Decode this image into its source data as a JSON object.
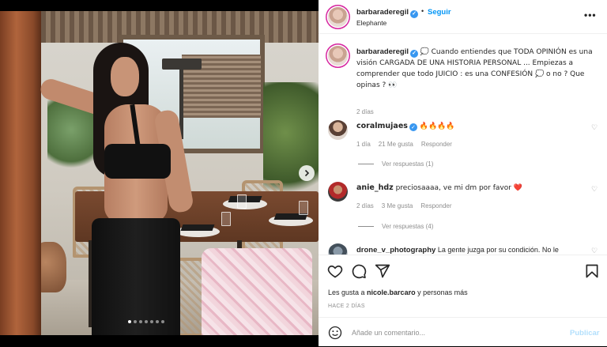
{
  "post": {
    "username": "barbaraderegil",
    "follow_label": "Seguir",
    "location": "Elephante",
    "caption": "💭 Cuando entiendes que TODA OPINIÓN es una visión CARGADA DE UNA HISTORIA PERSONAL ... Empiezas a comprender que todo JUICIO : es una CONFESIÓN 💭 o no ? Que opinas ? 👀",
    "caption_time": "2 días",
    "carousel": {
      "slide_count": 7,
      "active_index": 0
    }
  },
  "comments": [
    {
      "username": "coralmujaes",
      "text": "🔥🔥🔥🔥",
      "time": "1 día",
      "likes": "21 Me gusta",
      "reply_label": "Responder",
      "replies_label": "Ver respuestas (1)"
    },
    {
      "username": "anie_hdz",
      "text": "preciosaaaa, ve mi dm por favor ❤️",
      "time": "2 días",
      "likes": "3 Me gusta",
      "reply_label": "Responder",
      "replies_label": "Ver respuestas (4)"
    },
    {
      "username": "drone_v_photography",
      "text": "La gente juzga por su condición. No le",
      "time": "",
      "likes": "",
      "reply_label": "",
      "replies_label": ""
    }
  ],
  "actions": {
    "likes_prefix": "Les gusta a ",
    "likes_user": "nicole.barcaro",
    "likes_suffix": " y personas más",
    "date": "HACE 2 DÍAS",
    "comment_placeholder": "Añade un comentario...",
    "publish_label": "Publicar"
  },
  "icons": {
    "header_more": "more-options-icon",
    "like": "heart-icon",
    "comment": "comment-icon",
    "share": "share-icon",
    "save": "bookmark-icon",
    "emoji": "emoji-icon",
    "verified": "verified-badge-icon",
    "carousel_next": "chevron-right-icon"
  },
  "colors": {
    "link_blue": "#0095f6",
    "verified_blue": "#3897f0",
    "muted_text": "#8e8e8e",
    "publish_disabled": "#b2dffc"
  }
}
